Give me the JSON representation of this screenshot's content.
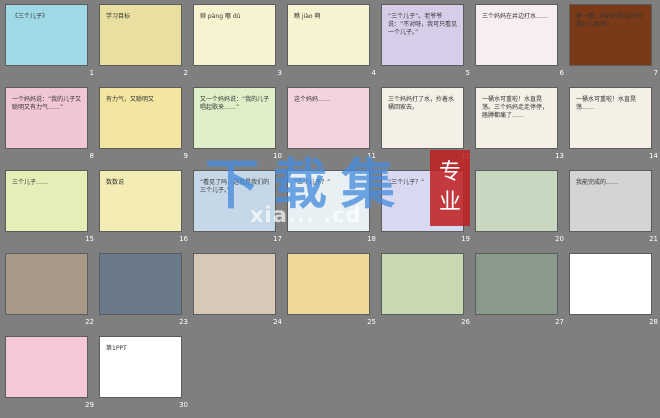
{
  "slides": [
    {
      "num": "1",
      "text": "《三个儿子》",
      "bg": "#9fd9e6"
    },
    {
      "num": "2",
      "text": "学习目标",
      "bg": "#e8dfa0"
    },
    {
      "num": "3",
      "text": "辫 pàng 嘟 dū",
      "bg": "#f7f3d0"
    },
    {
      "num": "4",
      "text": "瞧 jiào 啊",
      "bg": "#f7f3d0"
    },
    {
      "num": "5",
      "text": "“三个儿子”。老爷爷说：“不对呀，我可只看见一个儿子。”",
      "bg": "#d8cde8"
    },
    {
      "num": "6",
      "text": "三个妈妈在井边打水……",
      "bg": "#f6eef0"
    },
    {
      "num": "7",
      "text": "第一题：妈妈们的话分别是什么意思？",
      "bg": "#7a3a18"
    },
    {
      "num": "8",
      "text": "一个妈妈说：“我的儿子又聪明又有力气……”",
      "bg": "#f0c6d4"
    },
    {
      "num": "9",
      "text": "有力气，又聪明又",
      "bg": "#f3e6a0"
    },
    {
      "num": "10",
      "text": "又一个妈妈说：“我的儿子唱起歌来……”",
      "bg": "#dff0c8"
    },
    {
      "num": "11",
      "text": "这个妈妈……",
      "bg": "#f4d4dc"
    },
    {
      "num": "12",
      "text": "三个妈妈打了水，拎着水桶回家去。",
      "bg": "#f5f0e6"
    },
    {
      "num": "13",
      "text": "一桶水可重啦！水直晃荡。三个妈妈走走停停，胳膊都痛了……",
      "bg": "#f5f0e6"
    },
    {
      "num": "14",
      "text": "一桶水可重啦！水直晃荡……",
      "bg": "#f5f0e6"
    },
    {
      "num": "15",
      "text": "三个儿子……",
      "bg": "#e4efb8"
    },
    {
      "num": "16",
      "text": "数数说",
      "bg": "#f3ecb4"
    },
    {
      "num": "17",
      "text": "“看见了吗，这就是我们的三个儿子。”",
      "bg": "#c6d8e8"
    },
    {
      "num": "18",
      "text": "“三个儿子？”",
      "bg": "#e8f0f4"
    },
    {
      "num": "19",
      "text": "“三个儿子？”",
      "bg": "#d8d8f0"
    },
    {
      "num": "20",
      "text": "",
      "bg": "#c8d8c0"
    },
    {
      "num": "21",
      "text": "我能完成的……",
      "bg": "#d4d4d4"
    },
    {
      "num": "22",
      "text": "",
      "bg": "#a89888"
    },
    {
      "num": "23",
      "text": "",
      "bg": "#6a7a8a"
    },
    {
      "num": "24",
      "text": "",
      "bg": "#d8c8b8"
    },
    {
      "num": "25",
      "text": "",
      "bg": "#f0d898"
    },
    {
      "num": "26",
      "text": "",
      "bg": "#c8d8b0"
    },
    {
      "num": "27",
      "text": "",
      "bg": "#8a9a8a"
    },
    {
      "num": "28",
      "text": "",
      "bg": "#ffffff"
    },
    {
      "num": "29",
      "text": "",
      "bg": "#f4c8d8"
    },
    {
      "num": "30",
      "text": "第1PPT",
      "bg": "#ffffff"
    }
  ],
  "watermark": {
    "title": "下载集",
    "badge": "专业",
    "url": "xia... .cd"
  }
}
